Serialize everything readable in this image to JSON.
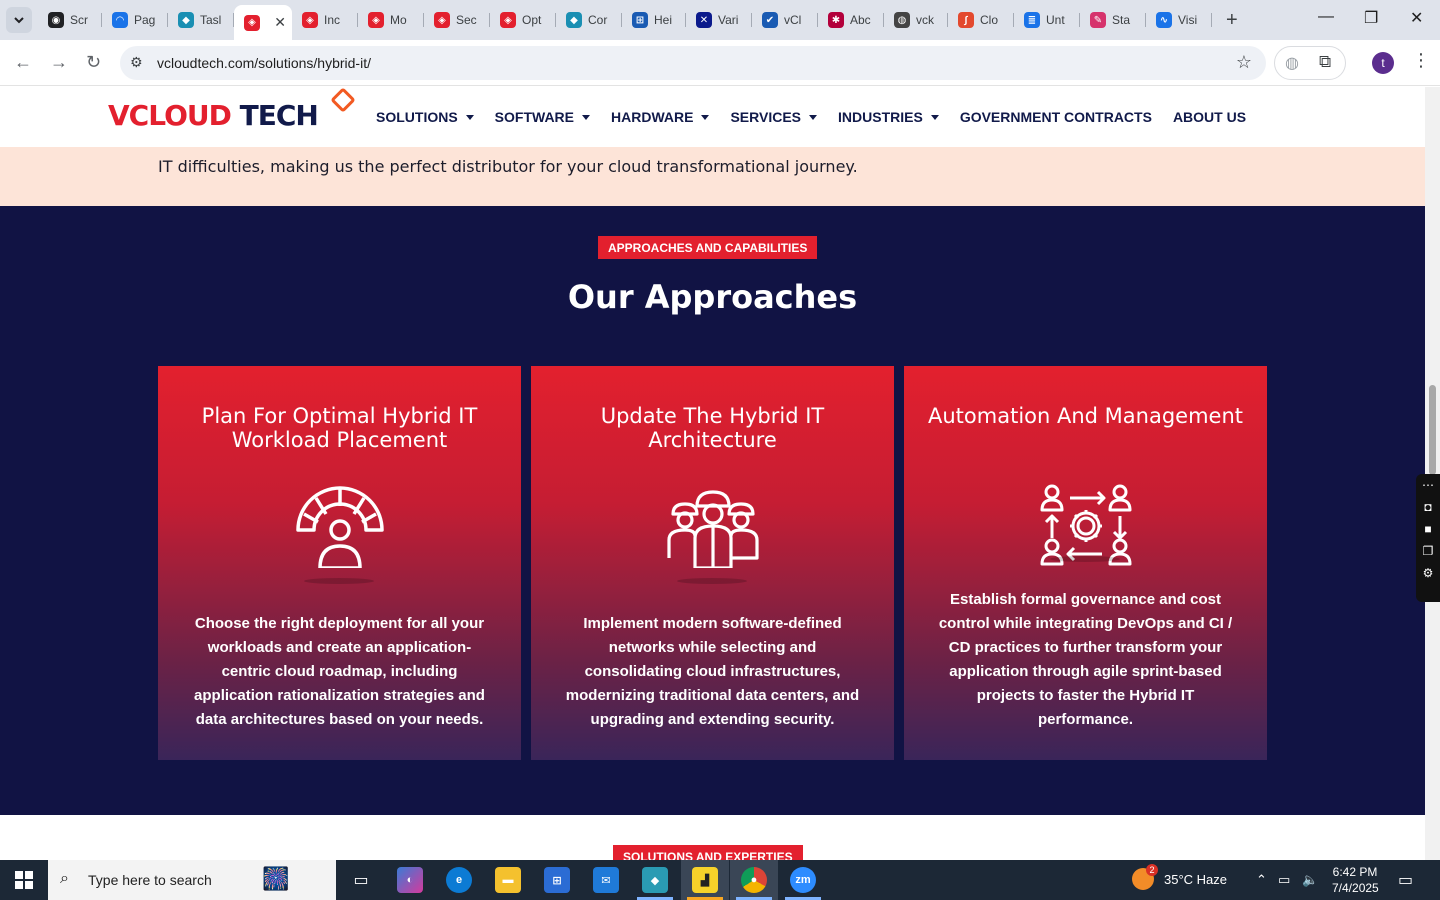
{
  "browser": {
    "tabs": [
      {
        "label": "Scr",
        "color": "#202124",
        "glyph": "◉"
      },
      {
        "label": "Pag",
        "color": "#1a73e8",
        "glyph": "◠"
      },
      {
        "label": "Tasl",
        "color": "#1a8fb3",
        "glyph": "◆"
      },
      {
        "label": "",
        "color": "#e3202e",
        "glyph": "◈",
        "active": true
      },
      {
        "label": "Inc",
        "color": "#e3202e",
        "glyph": "◈"
      },
      {
        "label": "Mo",
        "color": "#e3202e",
        "glyph": "◈"
      },
      {
        "label": "Sec",
        "color": "#e3202e",
        "glyph": "◈"
      },
      {
        "label": "Opt",
        "color": "#e3202e",
        "glyph": "◈"
      },
      {
        "label": "Cor",
        "color": "#1a8fb3",
        "glyph": "◆"
      },
      {
        "label": "Hei",
        "color": "#1a5bb3",
        "glyph": "⊞"
      },
      {
        "label": "Vari",
        "color": "#0b1a8c",
        "glyph": "✕"
      },
      {
        "label": "vCl",
        "color": "#1a5bb3",
        "glyph": "✔"
      },
      {
        "label": "Abc",
        "color": "#b3003b",
        "glyph": "✱"
      },
      {
        "label": "vck",
        "color": "#444",
        "glyph": "◍"
      },
      {
        "label": "Clo",
        "color": "#e3492e",
        "glyph": "∫"
      },
      {
        "label": "Unt",
        "color": "#1a73e8",
        "glyph": "≣"
      },
      {
        "label": "Sta",
        "color": "#d6336c",
        "glyph": "✎"
      },
      {
        "label": "Visi",
        "color": "#1a73e8",
        "glyph": "∿"
      }
    ],
    "active_close": "✕",
    "new_tab": "+",
    "url": "vcloudtech.com/solutions/hybrid-it/",
    "profile_initial": "t"
  },
  "site": {
    "logo": {
      "v": "V",
      "cloud": "CLOUD",
      "tech": " TECH"
    },
    "nav": [
      {
        "label": "SOLUTIONS",
        "caret": true
      },
      {
        "label": "SOFTWARE",
        "caret": true
      },
      {
        "label": "HARDWARE",
        "caret": true
      },
      {
        "label": "SERVICES",
        "caret": true
      },
      {
        "label": "INDUSTRIES",
        "caret": true
      },
      {
        "label": "GOVERNMENT CONTRACTS",
        "caret": false
      },
      {
        "label": "ABOUT US",
        "caret": false
      }
    ],
    "intro_tail": "IT difficulties, making us the perfect distributor for your cloud transformational journey.",
    "approaches": {
      "kicker": "APPROACHES AND CAPABILITIES",
      "heading": "Our Approaches",
      "cards": [
        {
          "title": "Plan For Optimal Hybrid IT Workload Placement",
          "icon": "gauge-person-icon",
          "desc": "Choose the right deployment for all your workloads and create an application-centric cloud roadmap, including application rationalization strategies and data architectures based on your needs."
        },
        {
          "title": "Update The Hybrid IT Architecture",
          "icon": "engineers-team-icon",
          "desc": "Implement modern software-defined networks while selecting and consolidating cloud infrastructures, modernizing traditional data centers, and upgrading and extending security."
        },
        {
          "title": "Automation And Management",
          "icon": "people-gear-flow-icon",
          "desc": "Establish formal governance and cost control while integrating DevOps and CI / CD practices to further transform your application through agile sprint-based projects to faster the Hybrid IT performance."
        }
      ]
    },
    "next_kicker": "SOLUTIONS AND EXPERTIES",
    "colors": {
      "brand_red": "#e3202e",
      "navy": "#111344",
      "peach": "#fde4d8"
    }
  },
  "taskbar": {
    "search_placeholder": "Type here to search",
    "weather": "35°C  Haze",
    "weather_badge": "2",
    "time": "6:42 PM",
    "date": "7/4/2025",
    "apps": [
      "zm"
    ]
  }
}
